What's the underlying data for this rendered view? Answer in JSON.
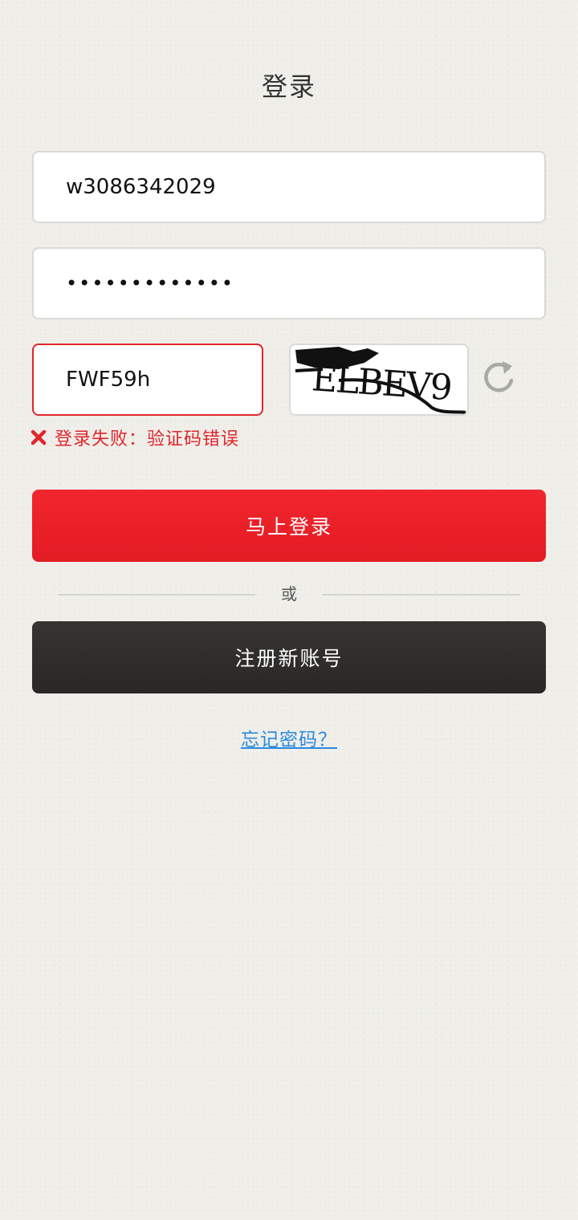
{
  "header": {
    "title": "登录"
  },
  "form": {
    "username": {
      "value": "w3086342029"
    },
    "password": {
      "value": "•••••••••••••"
    },
    "captcha": {
      "value": "FWF59h",
      "image_text": "ELBEV9"
    },
    "error_message": "登录失败：验证码错误"
  },
  "actions": {
    "login_label": "马上登录",
    "divider_label": "或",
    "register_label": "注册新账号",
    "forgot_label": "忘记密码？"
  },
  "colors": {
    "primary_red": "#e31b24",
    "dark_button": "#2f2d2b",
    "link_blue": "#2a8ae0",
    "background": "#efeee9"
  },
  "icons": {
    "refresh": "refresh-icon",
    "error": "close-x-icon"
  }
}
